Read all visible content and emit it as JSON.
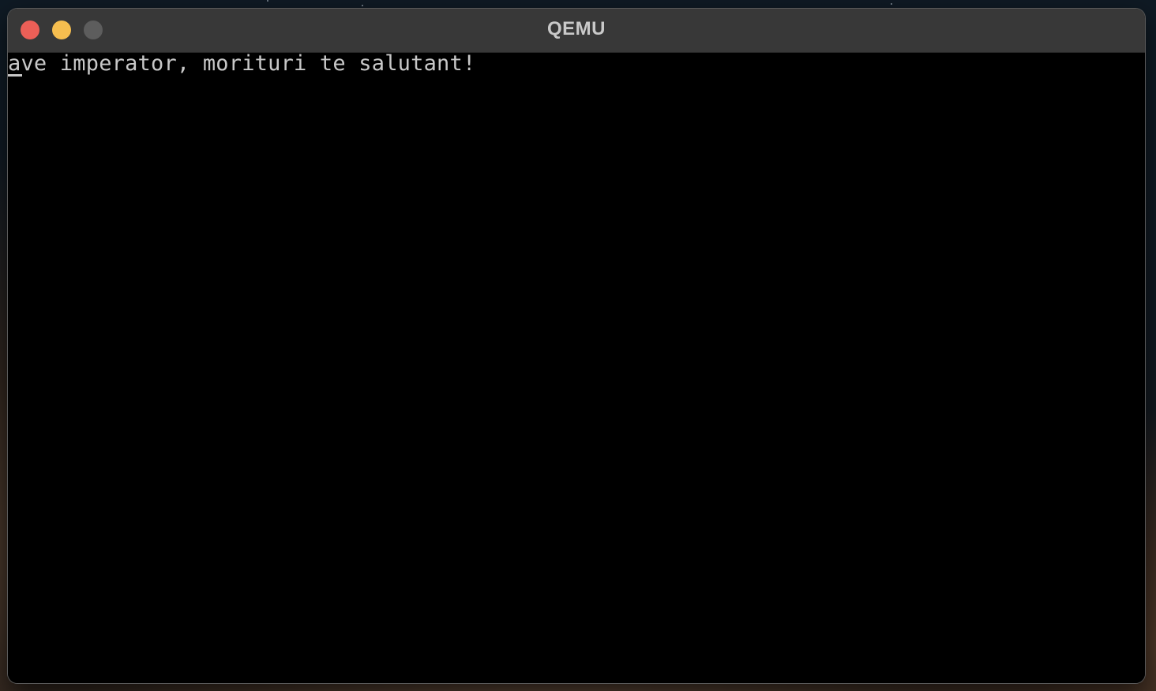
{
  "window": {
    "title": "QEMU",
    "controls": {
      "close_color": "#ec5f57",
      "minimize_color": "#f6be4f",
      "zoom_color": "#5d5d5d"
    }
  },
  "console": {
    "lines": [
      "ave imperator, morituri te salutant!"
    ],
    "text_color": "#c8c8c8",
    "background_color": "#000000"
  }
}
